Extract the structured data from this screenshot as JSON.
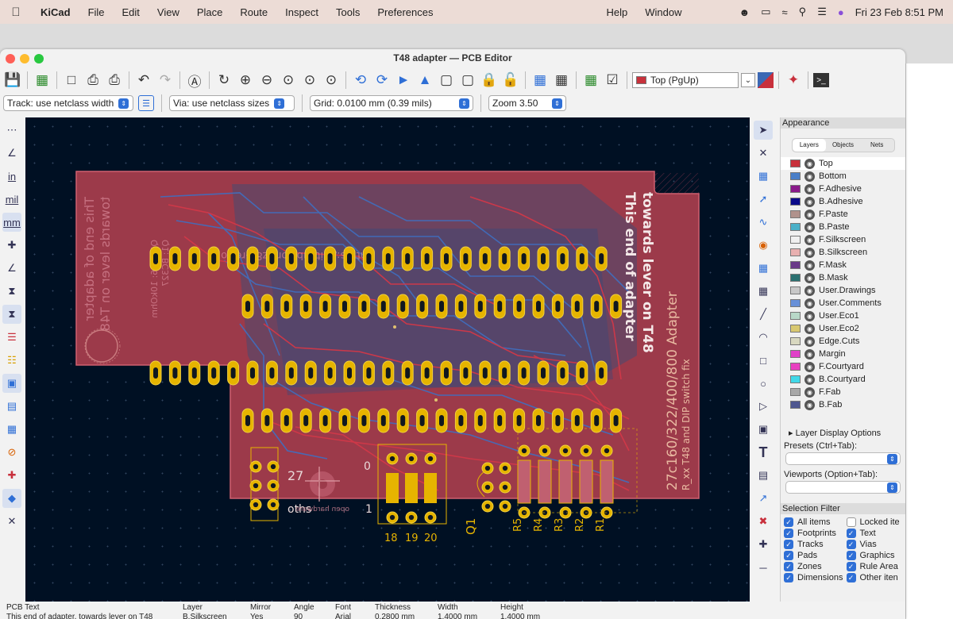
{
  "menubar": {
    "app": "KiCad",
    "items": [
      "File",
      "Edit",
      "View",
      "Place",
      "Route",
      "Inspect",
      "Tools",
      "Preferences"
    ],
    "right_items": [
      "Help",
      "Window"
    ],
    "clock": "Fri 23 Feb  8:51 PM"
  },
  "window": {
    "title": "T48 adapter — PCB Editor"
  },
  "toolbar": {
    "layer": "Top (PgUp)"
  },
  "toolbar2": {
    "track": "Track: use netclass width",
    "via": "Via: use netclass sizes",
    "grid": "Grid: 0.0100 mm (0.39 mils)",
    "zoom": "Zoom 3.50"
  },
  "left_tools": {
    "in": "in",
    "mil": "mil",
    "mm": "mm"
  },
  "colors": {
    "board": "#9c3a4a",
    "copper_top": "#c8303c",
    "copper_bottom": "#3b68b4",
    "pad": "#e6b400",
    "silk": "#f2e6e6",
    "canvas": "#001023"
  },
  "pcb": {
    "silk1": "This end of adapter",
    "silk2": "towards lever on T48",
    "silk3": "27c160/322/400/800 Adapter",
    "silk4": "R_xx T48 and DIP switch fix",
    "mirror1": "This end of adapter",
    "mirror2": "towards lever on T48",
    "mirror3": "Q1  R1-6: 10kOhm",
    "mirror4": "Q1: BC327",
    "mirror5": "https://github.com/z80-retro",
    "lbl_27": "27",
    "lbl_0": "0",
    "lbl_1": "1",
    "lbl_oths": "oths",
    "lbl_oh": "open hardware",
    "lbl_18": "18",
    "lbl_19": "19",
    "lbl_20": "20",
    "lbl_q1": "Q1",
    "r_labels": [
      "R5",
      "R4",
      "R3",
      "R2",
      "R1"
    ]
  },
  "appearance": {
    "title": "Appearance",
    "tabs": [
      "Layers",
      "Objects",
      "Nets"
    ],
    "layers": [
      {
        "name": "Top",
        "color": "#c8323c"
      },
      {
        "name": "Bottom",
        "color": "#4a7fc8"
      },
      {
        "name": "F.Adhesive",
        "color": "#8a1a8a"
      },
      {
        "name": "B.Adhesive",
        "color": "#0a0a8a"
      },
      {
        "name": "F.Paste",
        "color": "#b0928c"
      },
      {
        "name": "B.Paste",
        "color": "#4ab0c8"
      },
      {
        "name": "F.Silkscreen",
        "color": "#f0f0f0"
      },
      {
        "name": "B.Silkscreen",
        "color": "#e8b0b0"
      },
      {
        "name": "F.Mask",
        "color": "#6a3a88"
      },
      {
        "name": "B.Mask",
        "color": "#2a7070"
      },
      {
        "name": "User.Drawings",
        "color": "#c8c8c8"
      },
      {
        "name": "User.Comments",
        "color": "#6890d8"
      },
      {
        "name": "User.Eco1",
        "color": "#b8d8c8"
      },
      {
        "name": "User.Eco2",
        "color": "#d8c870"
      },
      {
        "name": "Edge.Cuts",
        "color": "#d8d8c0"
      },
      {
        "name": "Margin",
        "color": "#e040c8"
      },
      {
        "name": "F.Courtyard",
        "color": "#e840c0"
      },
      {
        "name": "B.Courtyard",
        "color": "#40d8e8"
      },
      {
        "name": "F.Fab",
        "color": "#a8a8a8"
      },
      {
        "name": "B.Fab",
        "color": "#505890"
      }
    ],
    "display_options": "Layer Display Options",
    "presets_label": "Presets (Ctrl+Tab):",
    "viewports_label": "Viewports (Option+Tab):",
    "selection_filter": "Selection Filter",
    "filters": [
      [
        "All items",
        "Locked ite"
      ],
      [
        "Footprints",
        "Text"
      ],
      [
        "Tracks",
        "Vias"
      ],
      [
        "Pads",
        "Graphics"
      ],
      [
        "Zones",
        "Rule Area"
      ],
      [
        "Dimensions",
        "Other iten"
      ]
    ]
  },
  "status": {
    "headers": [
      "PCB Text",
      "Layer",
      "Mirror",
      "Angle",
      "Font",
      "Thickness",
      "Width",
      "Height"
    ],
    "values": [
      "This end of adapter, towards lever on T48",
      "B.Silkscreen",
      "Yes",
      "90",
      "Arial",
      "0.2800 mm",
      "1.4000 mm",
      "1.4000 mm"
    ]
  }
}
